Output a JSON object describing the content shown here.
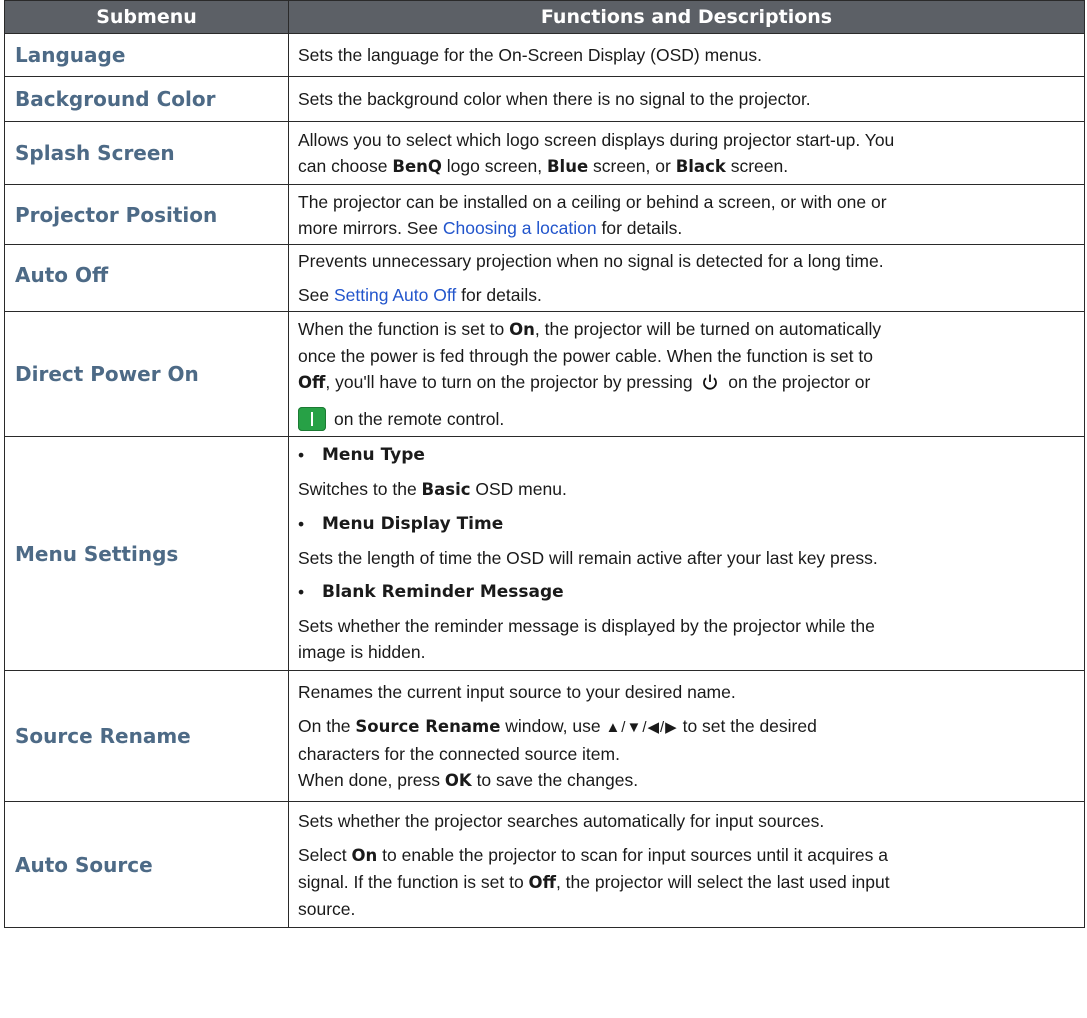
{
  "header": {
    "col1": "Submenu",
    "col2": "Functions and Descriptions"
  },
  "rows": [
    {
      "name": "Language",
      "lines": [
        "Sets the language for the On-Screen Display (OSD) menus."
      ]
    },
    {
      "name": "Background Color",
      "lines": [
        "Sets the background color when there is no signal to the projector."
      ]
    },
    {
      "name": "Splash Screen",
      "l1": "Allows you to select which logo screen displays during projector start-up. You",
      "l2a": "can choose ",
      "b1": "BenQ",
      "l2b": " logo screen, ",
      "b2": "Blue",
      "l2c": " screen, or ",
      "b3": "Black",
      "l2d": " screen."
    },
    {
      "name": "Projector Position",
      "l1": "The projector can be installed on a ceiling or behind a screen, or with one or",
      "l2a": "more mirrors. See ",
      "link": "Choosing a location",
      "l2b": " for details."
    },
    {
      "name": "Auto Off",
      "l1": "Prevents unnecessary projection when no signal is detected for a long time.",
      "l2a": "See ",
      "link": "Setting Auto Off",
      "l2b": " for details."
    },
    {
      "name": "Direct Power On",
      "l1a": "When the function is set to ",
      "b1": "On",
      "l1b": ", the projector will be turned on automatically",
      "l2": "once the power is fed through the power cable. When the function is set to",
      "b2": "Off",
      "l3a": ", you'll have to turn on the projector by pressing ",
      "l3b": " on the projector or",
      "l4": "on the remote control.",
      "icon1": "power-icon",
      "icon2": "remote-power-button-icon"
    },
    {
      "name": "Menu Settings",
      "bullet1": "Menu Type",
      "t1a": "Switches to the ",
      "t1b": "Basic",
      "t1c": " OSD menu.",
      "bullet2": "Menu Display Time",
      "t2": "Sets the length of time the OSD will remain active after your last key press.",
      "bullet3": "Blank Reminder Message",
      "t3a": "Sets whether the reminder message is displayed by the projector while the",
      "t3b": "image is hidden."
    },
    {
      "name": "Source Rename",
      "l1": "Renames the current input source to your desired name.",
      "l2a": "On the ",
      "b1": "Source Rename",
      "l2b": " window, use ",
      "arrows": "▲/▼/◀/▶",
      "l2c": " to set the desired",
      "l3": "characters for the connected source item.",
      "l4": "When done, press ",
      "b2": "OK",
      "l4b": " to save the changes."
    },
    {
      "name": "Auto Source",
      "l1": "Sets whether the projector searches automatically for input sources.",
      "l2a": "Select ",
      "b1": "On",
      "l2b": " to enable the projector to scan for input sources until it acquires a",
      "l3a": "signal. If the function is set to ",
      "b2": "Off",
      "l3b": ", the projector will select the last used input",
      "l4": "source."
    }
  ]
}
